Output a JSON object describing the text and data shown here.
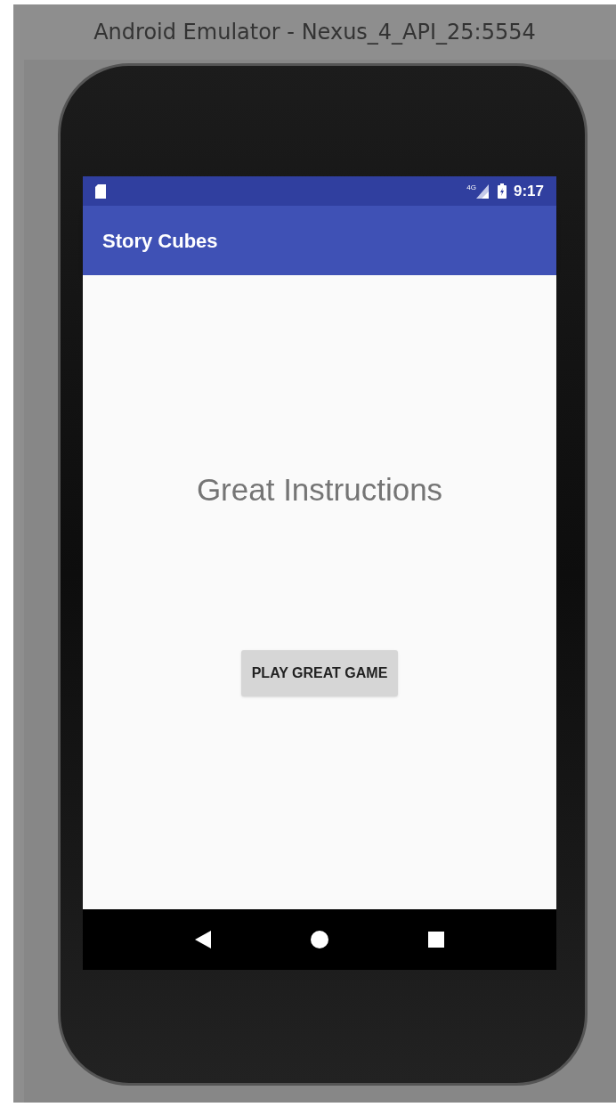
{
  "window": {
    "title": "Android Emulator - Nexus_4_API_25:5554"
  },
  "status_bar": {
    "network": "4G",
    "time": "9:17"
  },
  "app_bar": {
    "title": "Story Cubes"
  },
  "content": {
    "heading": "Great Instructions",
    "button": "PLAY GREAT GAME"
  }
}
